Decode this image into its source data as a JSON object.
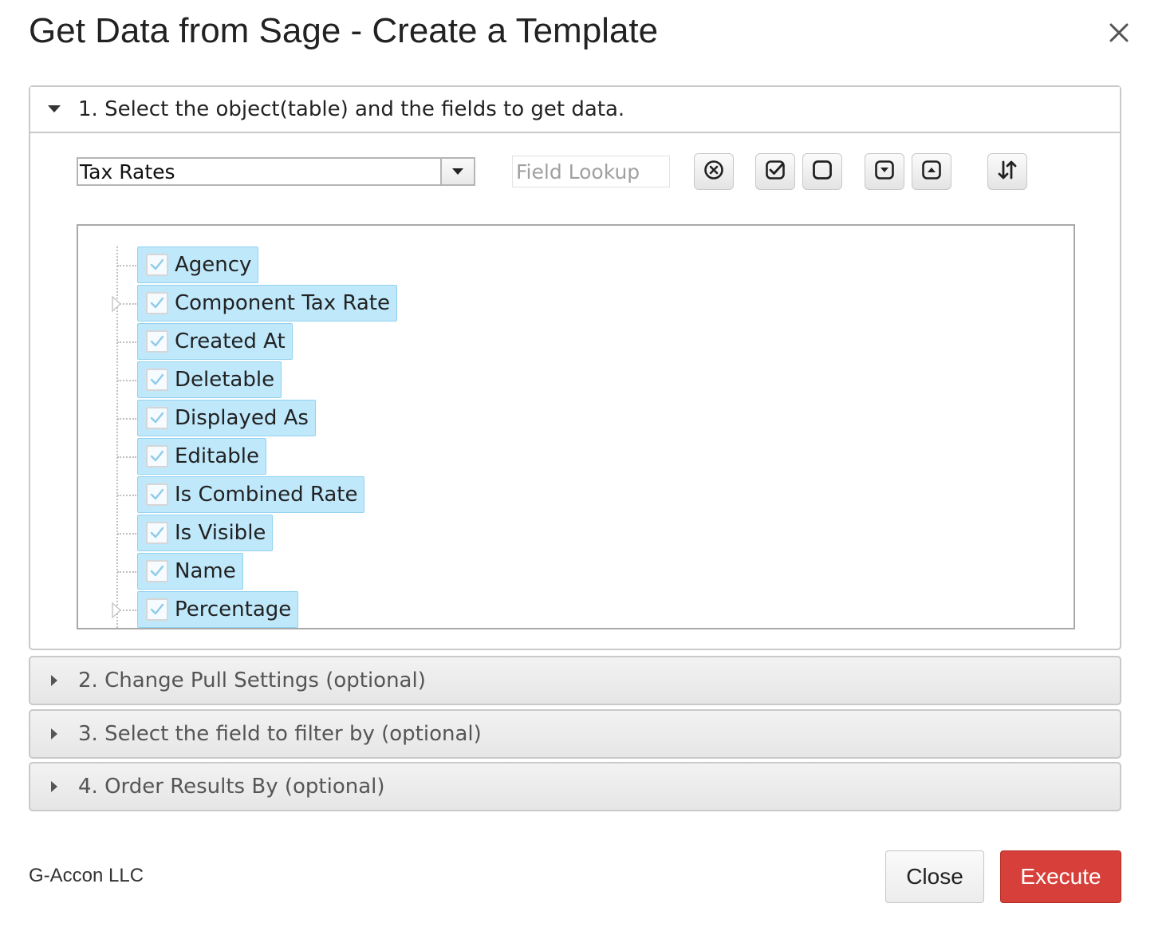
{
  "dialog": {
    "title": "Get Data from Sage - Create a Template",
    "close_icon": "close-icon"
  },
  "sections": [
    {
      "label": "1. Select the object(table) and the fields to get data.",
      "expanded": true
    },
    {
      "label": "2. Change Pull Settings (optional)",
      "expanded": false
    },
    {
      "label": "3. Select the field to filter by (optional)",
      "expanded": false
    },
    {
      "label": "4. Order Results By (optional)",
      "expanded": false
    }
  ],
  "object_select": {
    "value": "Tax Rates"
  },
  "field_lookup": {
    "placeholder": "Field Lookup",
    "value": ""
  },
  "toolbar_icons": [
    "clear-icon",
    "check-all-icon",
    "uncheck-all-icon",
    "expand-all-icon",
    "collapse-all-icon",
    "sort-icon"
  ],
  "fields": [
    {
      "label": "Agency",
      "checked": true,
      "expandable": false
    },
    {
      "label": "Component Tax Rate",
      "checked": true,
      "expandable": true
    },
    {
      "label": "Created At",
      "checked": true,
      "expandable": false
    },
    {
      "label": "Deletable",
      "checked": true,
      "expandable": false
    },
    {
      "label": "Displayed As",
      "checked": true,
      "expandable": false
    },
    {
      "label": "Editable",
      "checked": true,
      "expandable": false
    },
    {
      "label": "Is Combined Rate",
      "checked": true,
      "expandable": false
    },
    {
      "label": "Is Visible",
      "checked": true,
      "expandable": false
    },
    {
      "label": "Name",
      "checked": true,
      "expandable": false
    },
    {
      "label": "Percentage",
      "checked": true,
      "expandable": true
    }
  ],
  "footer": {
    "company": "G-Accon LLC",
    "close_label": "Close",
    "execute_label": "Execute"
  },
  "colors": {
    "execute": "#d7403a",
    "selected_field_bg": "#bfe8fb"
  }
}
